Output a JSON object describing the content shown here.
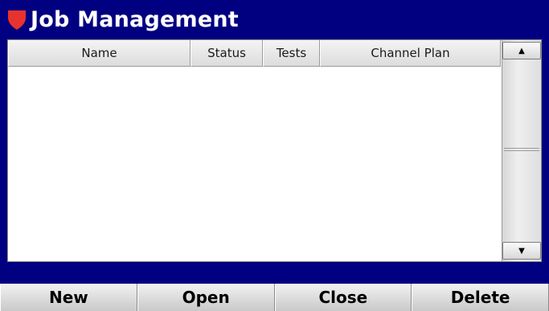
{
  "window": {
    "title": "Job Management",
    "logo_icon": "shield-icon",
    "colors": {
      "title_bar": "#000080",
      "logo": "#e8322e"
    }
  },
  "table": {
    "columns": [
      "Name",
      "Status",
      "Tests",
      "Channel Plan"
    ],
    "rows": []
  },
  "scrollbar": {
    "up_icon": "triangle-up-icon",
    "down_icon": "triangle-down-icon",
    "up_glyph": "▲",
    "down_glyph": "▼"
  },
  "buttons": {
    "new_label": "New",
    "open_label": "Open",
    "close_label": "Close",
    "delete_label": "Delete"
  }
}
